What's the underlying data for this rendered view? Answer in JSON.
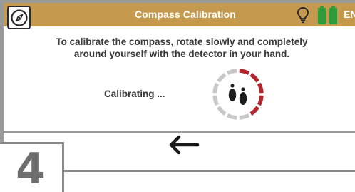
{
  "header": {
    "title": "Compass Calibration",
    "language": "EN",
    "background_color": "#c69a4e",
    "compass_icon": "compass-icon",
    "bulb_icon": "lightbulb-icon",
    "battery_icon": "battery-icon",
    "battery_color": "#2e9a3a"
  },
  "main": {
    "instructions": "To calibrate the compass, rotate slowly and completely around yourself with the detector in your hand.",
    "status": "Calibrating ...",
    "progress_ring": {
      "icon": "footprints-icon",
      "segments_total": 12,
      "segments_completed": 5,
      "completed_color": "#b3262c",
      "pending_color": "#c8c8c8"
    }
  },
  "footer": {
    "back_icon": "arrow-left-icon"
  },
  "step": {
    "number": "4"
  }
}
